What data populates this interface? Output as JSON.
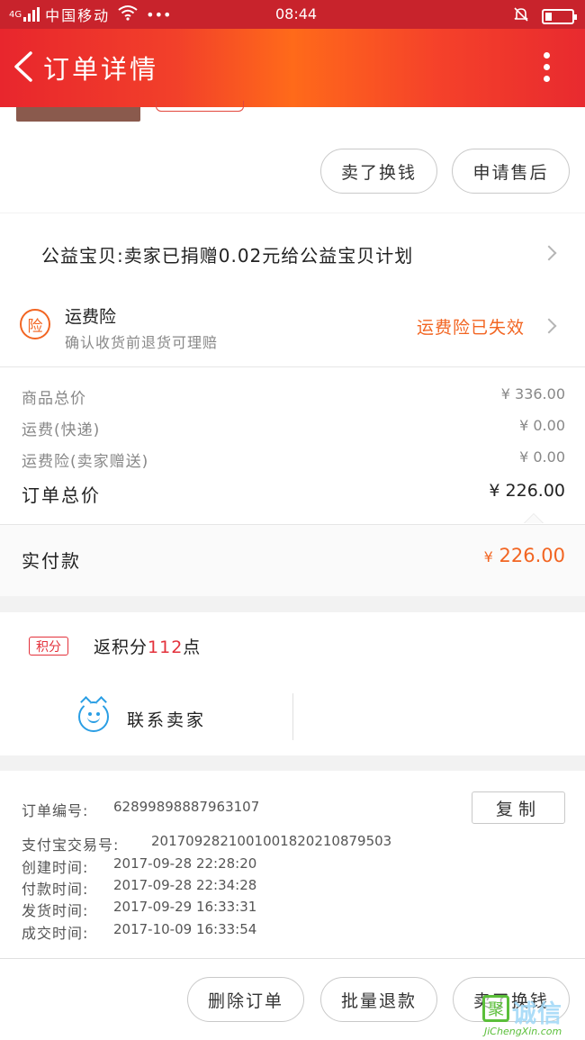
{
  "status_bar": {
    "network": "4G",
    "carrier": "中国移动",
    "dots": "•••",
    "time": "08:44"
  },
  "header": {
    "title": "订单详情"
  },
  "actions_top": {
    "sell_button": "卖了换钱",
    "after_sale_button": "申请售后"
  },
  "charity": {
    "text": "公益宝贝:卖家已捐赠0.02元给公益宝贝计划"
  },
  "insurance": {
    "badge": "险",
    "title": "运费险",
    "subtitle": "确认收货前退货可理赔",
    "status": "运费险已失效"
  },
  "pricing": {
    "rows": [
      {
        "label": "商品总价",
        "value": "¥ 336.00"
      },
      {
        "label": "运费(快递)",
        "value": "¥ 0.00"
      },
      {
        "label": "运费险(卖家赠送)",
        "value": "¥ 0.00"
      }
    ],
    "total_label": "订单总价",
    "total_value": "¥ 226.00",
    "paid_label": "实付款",
    "paid_currency": "¥",
    "paid_value": "226.00"
  },
  "points": {
    "badge": "积分",
    "prefix": "返积分",
    "amount": "112",
    "suffix": "点"
  },
  "contact": {
    "label": "联系卖家"
  },
  "order_info": {
    "copy_button": "复制",
    "rows": [
      {
        "label": "订单编号:",
        "value": "62899898887963107"
      },
      {
        "label": "支付宝交易号:",
        "value": "2017092821001001820210879503"
      },
      {
        "label": "创建时间:",
        "value": "2017-09-28 22:28:20"
      },
      {
        "label": "付款时间:",
        "value": "2017-09-28 22:34:28"
      },
      {
        "label": "发货时间:",
        "value": "2017-09-29 16:33:31"
      },
      {
        "label": "成交时间:",
        "value": "2017-10-09 16:33:54"
      }
    ]
  },
  "bottom_actions": {
    "delete_button": "删除订单",
    "batch_refund_button": "批量退款",
    "sell_button": "卖了换钱"
  },
  "watermark": {
    "logo_char": "聚",
    "name": "诚信",
    "url": "JiChengXin.com"
  },
  "colors": {
    "header_red": "#e8262d",
    "header_orange": "#ff6a1a",
    "accent_orange": "#f26522",
    "price_red": "#e3313b"
  }
}
